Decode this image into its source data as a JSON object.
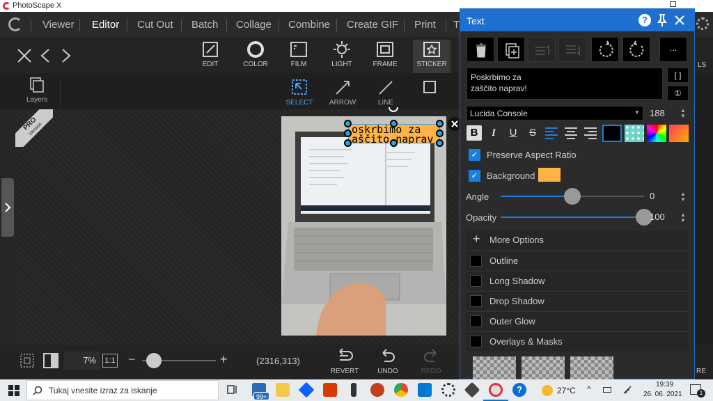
{
  "app": {
    "title": "PhotoScape X"
  },
  "menu": {
    "items": [
      "Viewer",
      "Editor",
      "Cut Out",
      "Batch",
      "Collage",
      "Combine",
      "Create GIF",
      "Print",
      "T"
    ],
    "active": "Editor"
  },
  "toolbar": {
    "tools": [
      "EDIT",
      "COLOR",
      "FILM",
      "LIGHT",
      "FRAME",
      "STICKER"
    ],
    "active": "STICKER",
    "right_partial": "LS"
  },
  "subtoolbar": {
    "layers": "Layers",
    "tools": [
      "SELECT",
      "ARROW",
      "LINE"
    ],
    "active": "SELECT"
  },
  "badge": {
    "pro": "PRO",
    "version": "Version"
  },
  "canvas": {
    "sticker_text_line1": "oskrbimo za",
    "sticker_text_line2": "aščito naprav"
  },
  "bottombar": {
    "zoom": "7%",
    "ratio": "1:1",
    "zoom_level": 0.16,
    "coords": "(2316,313)",
    "revert": "REVERT",
    "undo": "UNDO",
    "redo": "REDO",
    "right_partial": "RE"
  },
  "panel": {
    "title": "Text",
    "text_value": "Poskrbimo za\nzaščito naprav!",
    "bracket_label": "[ ]",
    "circle_label": "①",
    "more_label": "...",
    "font": "Lucida Console",
    "size": "188",
    "preserve_aspect": "Preserve Aspect Ratio",
    "background_label": "Background",
    "background_color": "#ffb347",
    "angle_label": "Angle",
    "angle_value": "0",
    "angle_fraction": 0.5,
    "opacity_label": "Opacity",
    "opacity_value": "100",
    "opacity_fraction": 1.0,
    "more_options": "More Options",
    "options": [
      "Outline",
      "Long Shadow",
      "Drop Shadow",
      "Outer Glow",
      "Overlays & Masks"
    ]
  },
  "taskbar": {
    "search_placeholder": "Tukaj vnesite izraz za iskanje",
    "mail_badge": "99+",
    "weather": "27°C",
    "time": "19:39",
    "date": "26. 06. 2021",
    "notif": "1"
  },
  "colors": {
    "accent": "#1e6fd0",
    "selection": "#29a3e0"
  }
}
